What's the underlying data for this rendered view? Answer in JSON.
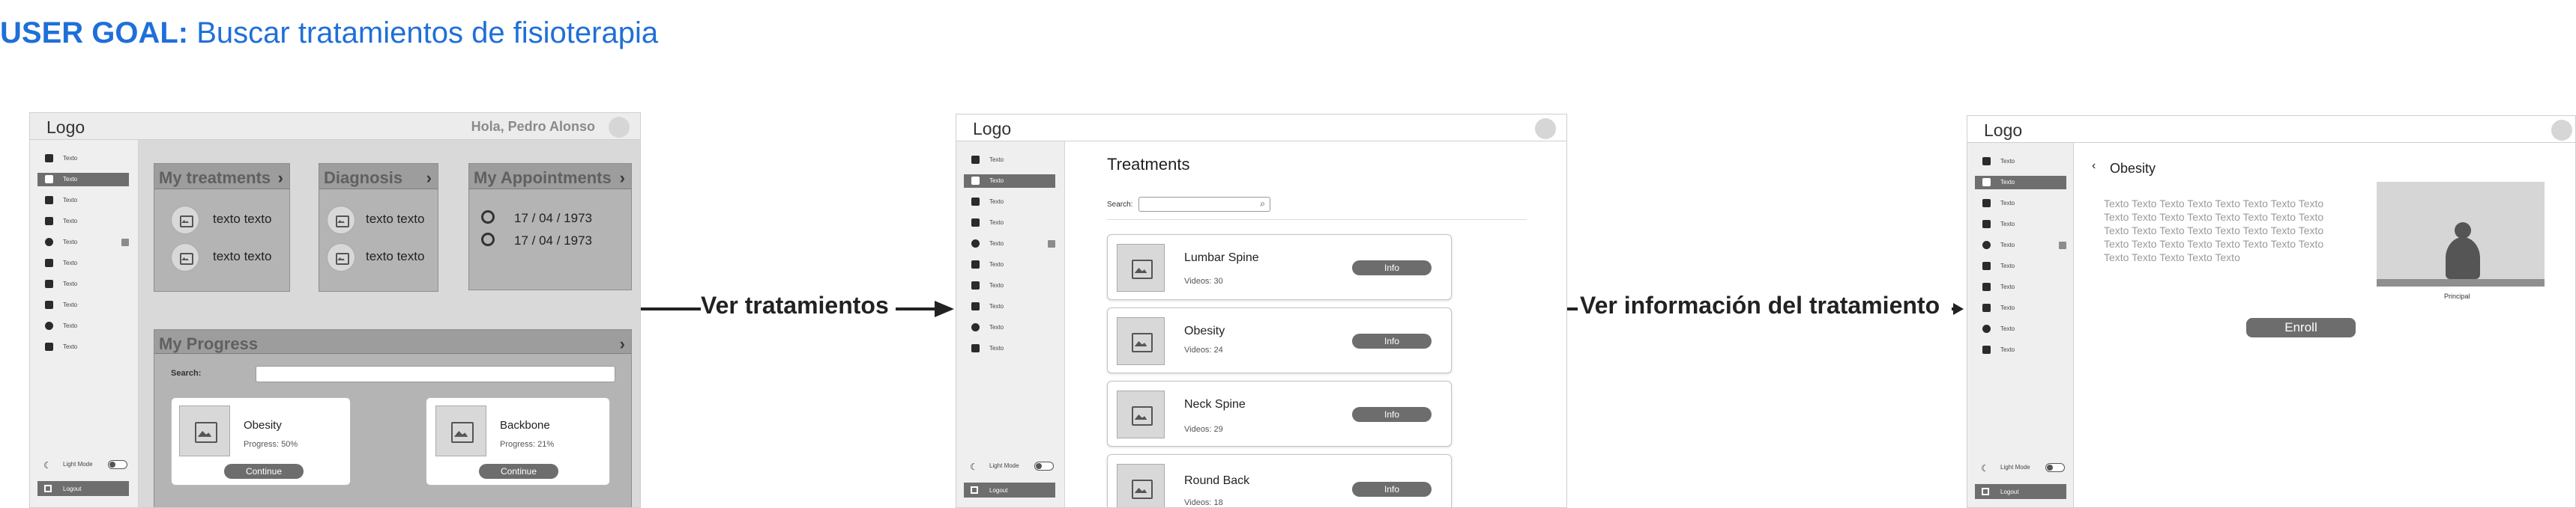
{
  "goal": {
    "prefix": "USER GOAL:",
    "text": "Buscar tratamientos de fisioterapia"
  },
  "sidebar_items": [
    {
      "label": "Texto",
      "icon": "home-icon"
    },
    {
      "label": "Texto",
      "icon": "checkbox-icon",
      "active": true
    },
    {
      "label": "Texto",
      "icon": "inbox-icon"
    },
    {
      "label": "Texto",
      "icon": "book-icon"
    },
    {
      "label": "Texto",
      "icon": "chat-icon",
      "badge": true
    },
    {
      "label": "Texto",
      "icon": "grid-icon"
    },
    {
      "label": "Texto",
      "icon": "bag-icon"
    },
    {
      "label": "Texto",
      "icon": "users-icon"
    },
    {
      "label": "Texto",
      "icon": "gear-icon"
    },
    {
      "label": "Texto",
      "icon": "apps-icon"
    }
  ],
  "sidebar_footer": {
    "mode_label": "Light Mode",
    "logout_label": "Logout"
  },
  "screen1": {
    "logo": "Logo",
    "greeting": "Hola, Pedro Alonso",
    "treatments": {
      "title": "My treatments",
      "items": [
        "texto texto",
        "texto texto"
      ]
    },
    "diagnosis": {
      "title": "Diagnosis",
      "items": [
        "texto texto",
        "texto texto"
      ]
    },
    "appointments": {
      "title": "My Appointments",
      "items": [
        "17 / 04 / 1973",
        "17 / 04 / 1973"
      ]
    },
    "progress": {
      "title": "My Progress",
      "search_label": "Search:",
      "cards": [
        {
          "name": "Obesity",
          "progress_label": "Progress: 50%",
          "button": "Continue"
        },
        {
          "name": "Backbone",
          "progress_label": "Progress: 21%",
          "button": "Continue"
        }
      ]
    }
  },
  "arrow1_label": "Ver tratamientos",
  "screen2": {
    "logo": "Logo",
    "title": "Treatments",
    "search_label": "Search:",
    "treatments": [
      {
        "name": "Lumbar Spine",
        "videos": "Videos: 30",
        "button": "Info"
      },
      {
        "name": "Obesity",
        "videos": "Videos: 24",
        "button": "Info"
      },
      {
        "name": "Neck Spine",
        "videos": "Videos: 29",
        "button": "Info"
      },
      {
        "name": "Round Back",
        "videos": "Videos: 18",
        "button": "Info"
      }
    ]
  },
  "arrow2_label": "Ver información del tratamiento",
  "screen3": {
    "logo": "Logo",
    "back_title": "Obesity",
    "description": "Texto Texto Texto Texto Texto Texto Texto Texto Texto Texto Texto Texto Texto Texto Texto Texto Texto Texto Texto Texto Texto Texto Texto Texto Texto Texto Texto Texto Texto Texto Texto Texto Texto Texto Texto Texto Texto",
    "media_caption": "Principal",
    "enroll_button": "Enroll"
  }
}
